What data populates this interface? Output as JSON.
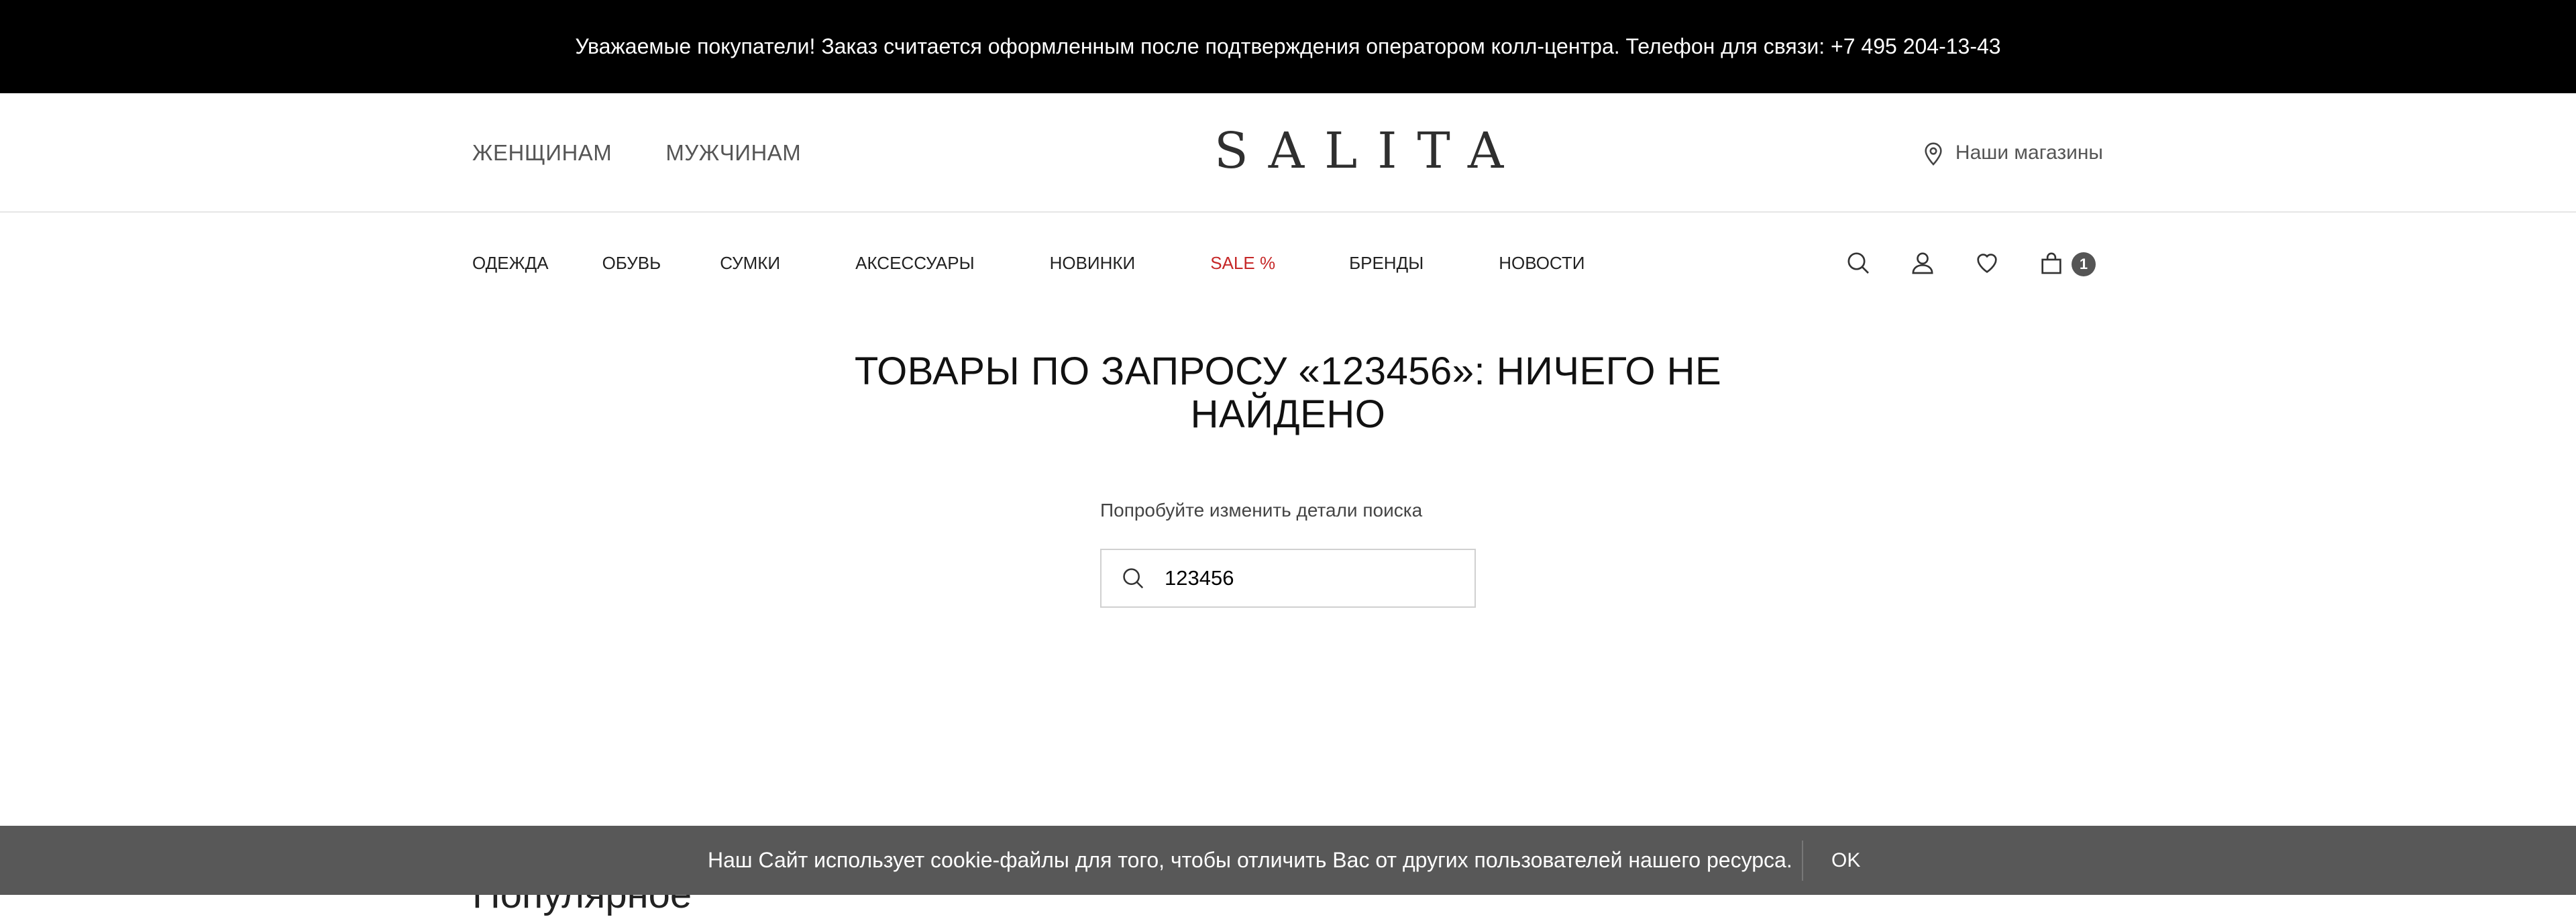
{
  "announcement": "Уважаемые покупатели! Заказ считается оформленным после подтверждения оператором колл-центра. Телефон для связи: +7 495 204-13-43",
  "header": {
    "gender_links": [
      "ЖЕНЩИНАМ",
      "МУЖЧИНАМ"
    ],
    "logo": "SALITA",
    "stores_label": "Наши магазины"
  },
  "categories": [
    "ОДЕЖДА",
    "ОБУВЬ",
    "СУМКИ",
    "АКСЕССУАРЫ",
    "НОВИНКИ",
    "SALE %",
    "БРЕНДЫ",
    "НОВОСТИ"
  ],
  "icons": [
    "search-icon",
    "user-icon",
    "heart-icon",
    "bag-icon"
  ],
  "cart_count": "1",
  "search_result": {
    "title": "ТОВАРЫ ПО ЗАПРОСУ «123456»: НИЧЕГО НЕ НАЙДЕНО",
    "hint": "Попробуйте изменить детали поиска",
    "query": "123456"
  },
  "popular_heading": "Популярное",
  "cookie": {
    "text": "Наш Сайт использует cookie-файлы для того, чтобы отличить Вас от других пользователей нашего ресурса.",
    "ok_label": "OK"
  },
  "colors": {
    "sale": "#c62828",
    "topbar": "#000000",
    "cookie_bar": "#585858"
  }
}
